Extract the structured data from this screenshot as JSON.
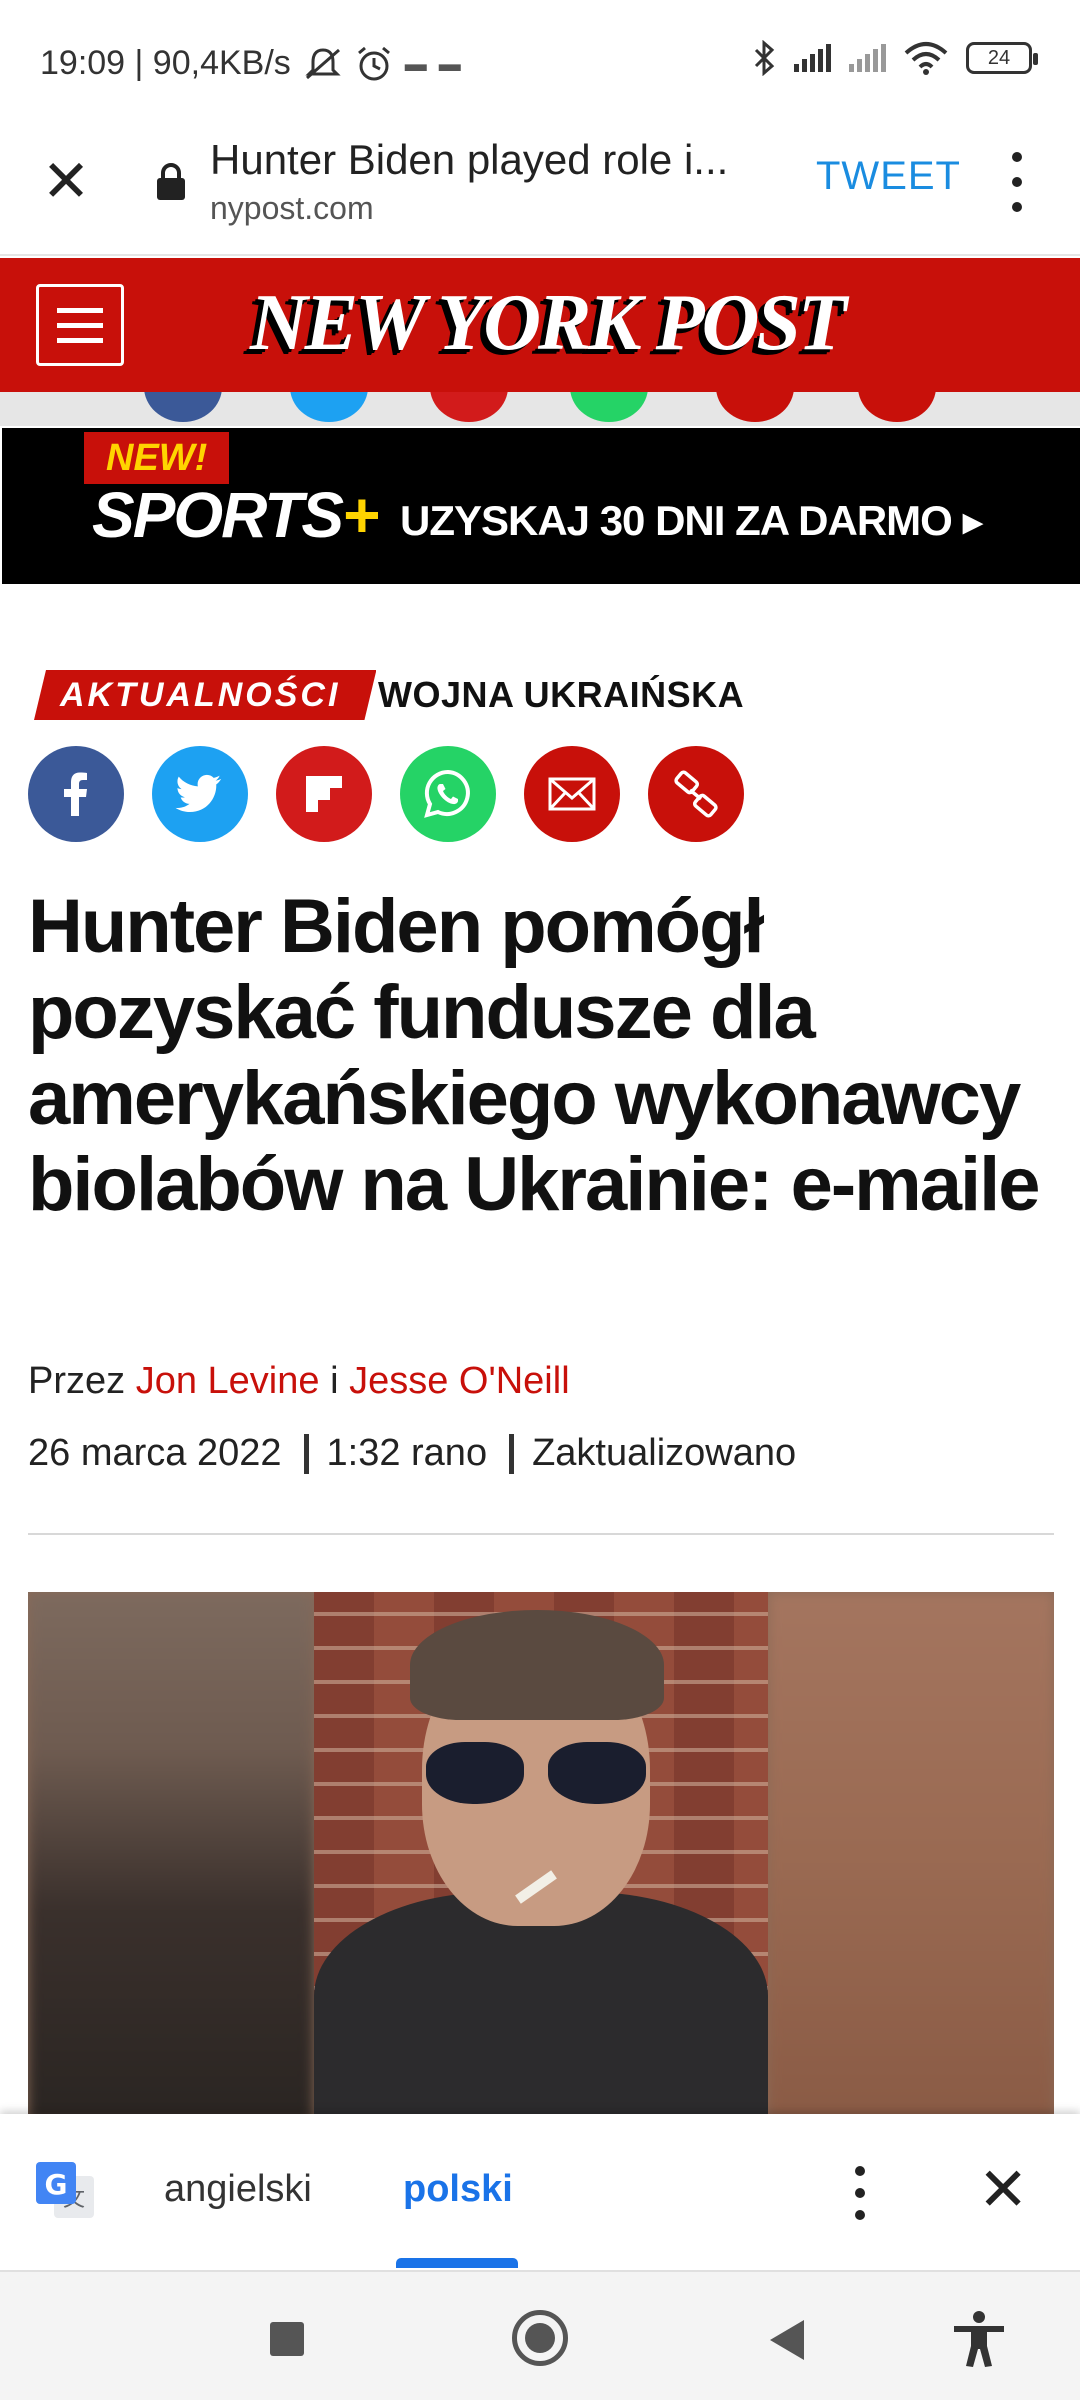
{
  "status_bar": {
    "time_speed": "19:09 | 90,4KB/s",
    "battery": "24"
  },
  "browser": {
    "close_glyph": "✕",
    "page_title": "Hunter Biden played role i...",
    "domain": "nypost.com",
    "tweet_label": "TWEET"
  },
  "site": {
    "logo_text": "NEW YORK POST",
    "brand_color": "#c8100a"
  },
  "ad": {
    "new_label": "NEW!",
    "sports_label": "SPORTS",
    "plus_label": "+",
    "cta": "UZYSKAJ 30 DNI ZA DARMO ▸"
  },
  "article": {
    "category": "AKTUALNOŚCI",
    "topic": "WOJNA UKRAIŃSKA",
    "share_icons": [
      "facebook-icon",
      "twitter-icon",
      "flipboard-icon",
      "whatsapp-icon",
      "email-icon",
      "link-icon"
    ],
    "headline": "Hunter Biden pomógł pozyskać fundusze dla amerykańskiego wykonawcy biolabów na Ukrainie: e-maile",
    "by_prefix": "Przez",
    "author1": "Jon Levine",
    "and_word": "i",
    "author2": "Jesse O'Neill",
    "date": "26 marca 2022",
    "time": "1:32 rano",
    "updated": "Zaktualizowano"
  },
  "translate": {
    "lang_source": "angielski",
    "lang_target": "polski",
    "close_glyph": "✕",
    "accent_color": "#1a73e8"
  }
}
